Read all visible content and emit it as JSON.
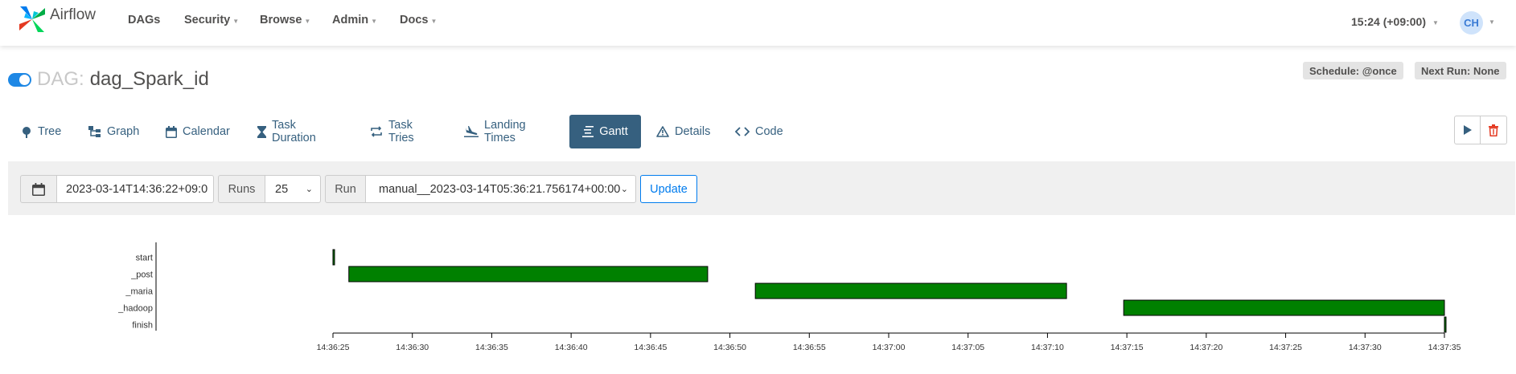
{
  "navbar": {
    "brand": "Airflow",
    "items": [
      {
        "label": "DAGs",
        "dropdown": false
      },
      {
        "label": "Security",
        "dropdown": true
      },
      {
        "label": "Browse",
        "dropdown": true
      },
      {
        "label": "Admin",
        "dropdown": true
      },
      {
        "label": "Docs",
        "dropdown": true
      }
    ],
    "clock": "15:24 (+09:00)",
    "user_initials": "CH"
  },
  "dag": {
    "prefix": "DAG:",
    "id": "dag_Spark_id",
    "paused": false,
    "schedule": "Schedule: @once",
    "next_run": "Next Run: None"
  },
  "tabs": [
    {
      "label": "Tree",
      "icon": "tree-icon",
      "active": false
    },
    {
      "label": "Graph",
      "icon": "graph-icon",
      "active": false
    },
    {
      "label": "Calendar",
      "icon": "calendar-icon",
      "active": false
    },
    {
      "label": "Task Duration",
      "icon": "hourglass-icon",
      "active": false
    },
    {
      "label": "Task Tries",
      "icon": "retry-icon",
      "active": false
    },
    {
      "label": "Landing Times",
      "icon": "plane-landing-icon",
      "active": false
    },
    {
      "label": "Gantt",
      "icon": "gantt-icon",
      "active": true
    },
    {
      "label": "Details",
      "icon": "warning-icon",
      "active": false
    },
    {
      "label": "Code",
      "icon": "code-icon",
      "active": false
    }
  ],
  "actions": {
    "trigger_icon": "play-icon",
    "delete_icon": "trash-icon"
  },
  "filters": {
    "execution_date": "2023-03-14T14:36:22+09:0",
    "runs_label": "Runs",
    "runs_value": "25",
    "run_label": "Run",
    "run_value": "manual__2023-03-14T05:36:21.756174+00:00",
    "update_label": "Update"
  },
  "colors": {
    "accent": "#017cee",
    "tab_active": "#36607f",
    "success": "#008000"
  },
  "chart_data": {
    "type": "gantt",
    "tasks": [
      {
        "name": "start",
        "start": "14:36:25.0",
        "end": "14:36:25.0"
      },
      {
        "name": "_post",
        "start": "14:36:26.0",
        "end": "14:36:48.6"
      },
      {
        "name": "_maria",
        "start": "14:36:51.6",
        "end": "14:37:11.2"
      },
      {
        "name": "_hadoop",
        "start": "14:37:14.8",
        "end": "14:37:35.0"
      },
      {
        "name": "finish",
        "start": "14:37:35.0",
        "end": "14:37:35.0"
      }
    ],
    "state": "success",
    "xlim": [
      "14:36:25",
      "14:37:35"
    ],
    "ticks": [
      "14:36:25",
      "14:36:30",
      "14:36:35",
      "14:36:40",
      "14:36:45",
      "14:36:50",
      "14:36:55",
      "14:37:00",
      "14:37:05",
      "14:37:10",
      "14:37:15",
      "14:37:20",
      "14:37:25",
      "14:37:30",
      "14:37:35"
    ]
  }
}
